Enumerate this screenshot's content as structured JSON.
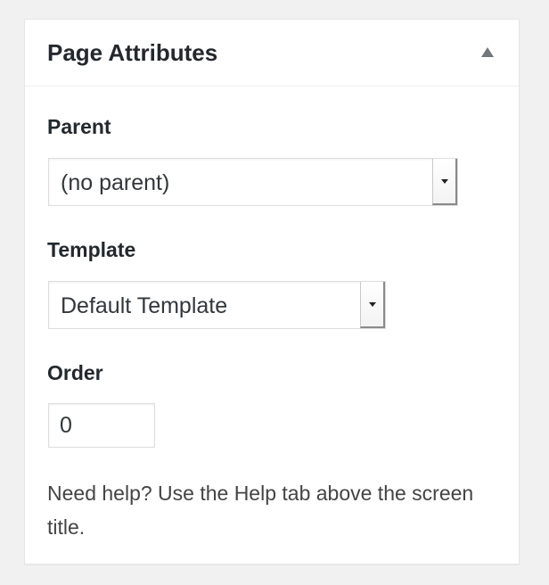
{
  "metabox": {
    "title": "Page Attributes"
  },
  "parent": {
    "label": "Parent",
    "selected": "(no parent)"
  },
  "template": {
    "label": "Template",
    "selected": "Default Template"
  },
  "order": {
    "label": "Order",
    "value": "0"
  },
  "help": {
    "text": "Need help? Use the Help tab above the screen title."
  },
  "icons": {
    "toggle": "triangle-up-icon",
    "dropdown": "chevron-down-icon"
  },
  "colors": {
    "background": "#f1f1f1",
    "panel": "#ffffff",
    "text": "#23282d",
    "muted_text": "#444444",
    "toggle_icon": "#72777c"
  }
}
